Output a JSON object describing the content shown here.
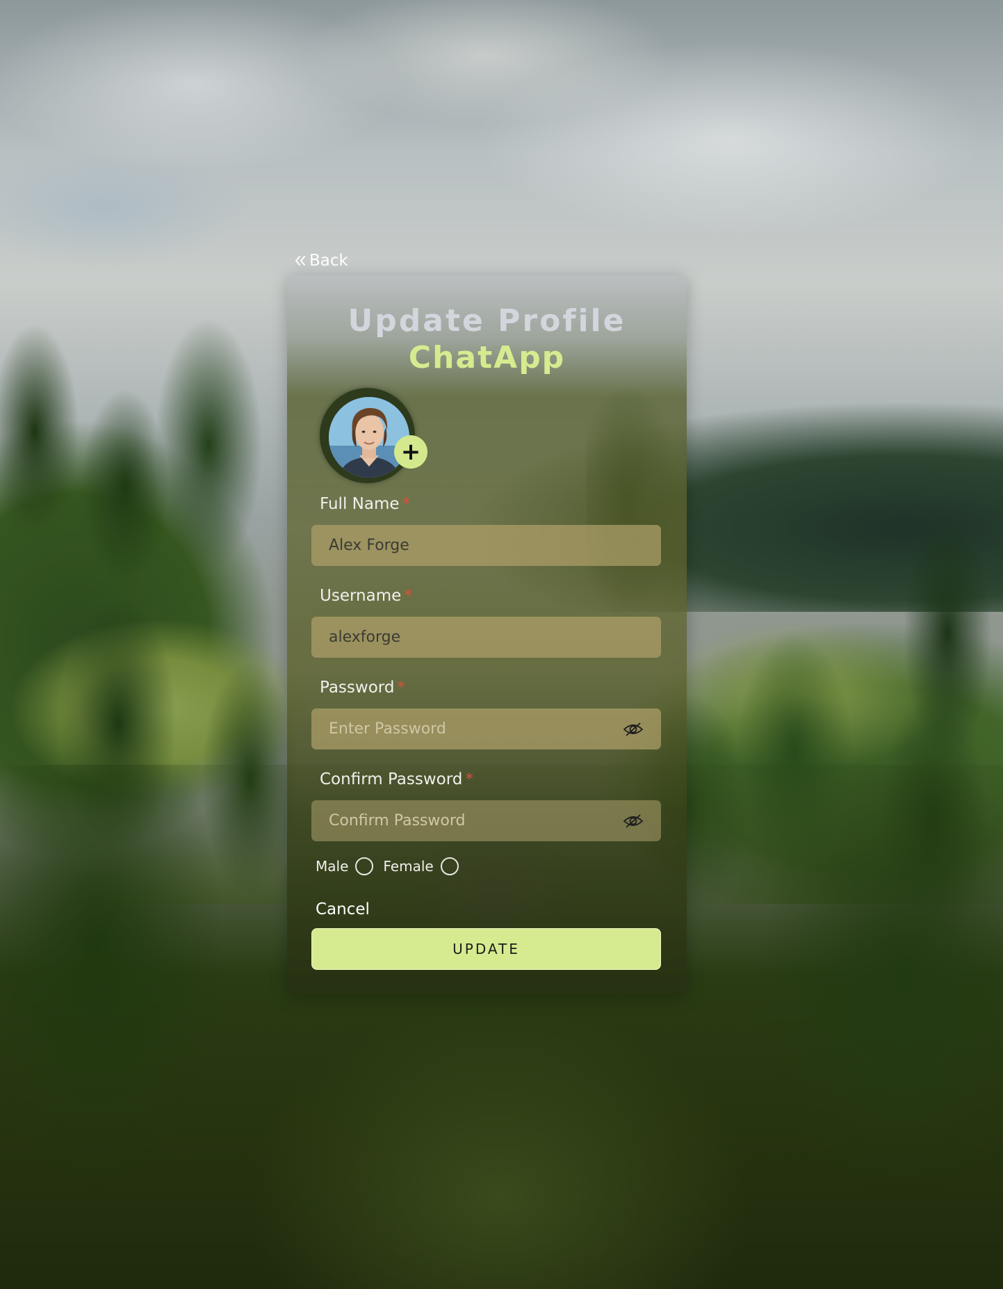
{
  "back": {
    "label": "Back"
  },
  "card": {
    "title": "Update Profile",
    "brand": "ChatApp"
  },
  "avatar": {
    "add_icon": "+"
  },
  "form": {
    "full_name": {
      "label": "Full Name",
      "required_mark": "*",
      "value": "Alex Forge",
      "placeholder": ""
    },
    "username": {
      "label": "Username",
      "required_mark": "*",
      "value": "alexforge",
      "placeholder": ""
    },
    "password": {
      "label": "Password",
      "required_mark": "*",
      "value": "",
      "placeholder": "Enter Password"
    },
    "confirm_password": {
      "label": "Confirm Password",
      "required_mark": "*",
      "value": "",
      "placeholder": "Confirm Password"
    },
    "gender": {
      "male_label": "Male",
      "female_label": "Female"
    }
  },
  "actions": {
    "cancel_label": "Cancel",
    "update_label": "UPDATE"
  },
  "colors": {
    "accent": "#d6eb8f",
    "required": "#e04d3a",
    "title": "#d3d6dc"
  },
  "icons": {
    "back": "double-chevron-left-icon",
    "add_photo": "plus-icon",
    "toggle_visibility": "eye-off-icon"
  }
}
